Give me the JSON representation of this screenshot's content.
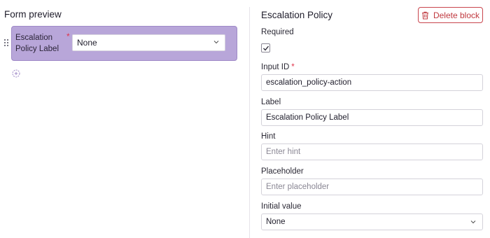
{
  "form_preview": {
    "title": "Form preview",
    "field": {
      "label": "Escalation Policy Label",
      "required_mark": "*",
      "select_value": "None"
    }
  },
  "block": {
    "title": "Escalation Policy",
    "delete_label": "Delete block",
    "required": {
      "label": "Required",
      "checked": true
    },
    "input_id": {
      "label": "Input ID",
      "required_mark": "*",
      "value": "escalation_policy-action"
    },
    "label_field": {
      "label": "Label",
      "value": "Escalation Policy Label"
    },
    "hint": {
      "label": "Hint",
      "placeholder": "Enter hint"
    },
    "placeholder_field": {
      "label": "Placeholder",
      "placeholder": "Enter placeholder"
    },
    "initial_value": {
      "label": "Initial value",
      "value": "None"
    }
  },
  "colors": {
    "preview_card": "#b8a6d9",
    "danger": "#c0393f",
    "required": "#e0344b"
  },
  "icons": {
    "drag": "drag-handle-icon",
    "add": "add-circle-icon",
    "delete": "trash-icon",
    "chevron": "chevron-down-icon",
    "check": "check-icon"
  }
}
